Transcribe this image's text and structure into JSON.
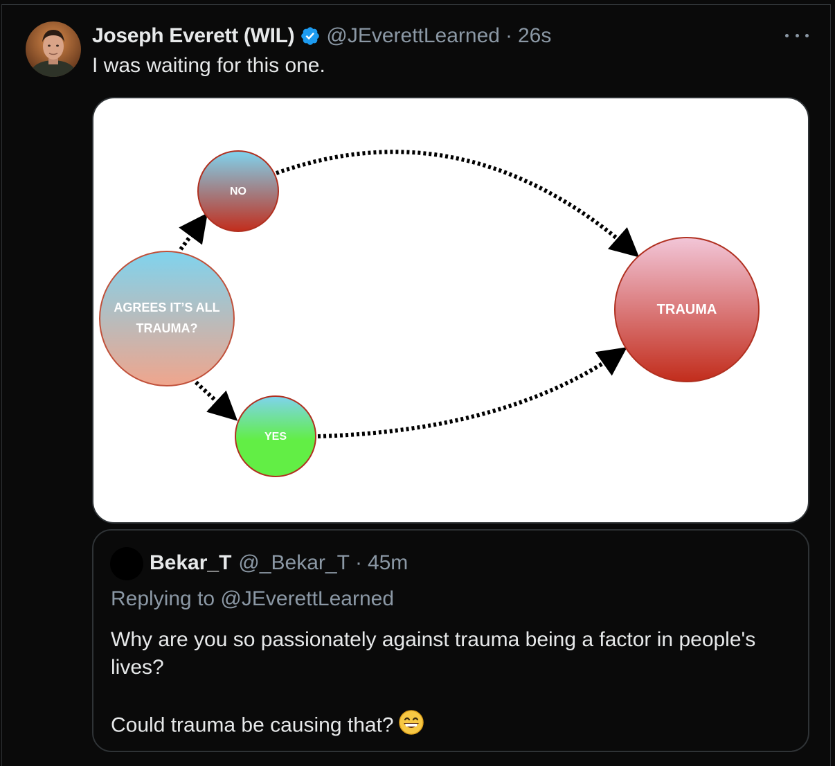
{
  "tweet": {
    "author_name": "Joseph Everett (WIL)",
    "handle": "@JEverettLearned",
    "separator": "·",
    "time": "26s",
    "text": "I was waiting for this one.",
    "verified_icon": "verified-badge-icon",
    "more_icon": "more-options-icon"
  },
  "diagram": {
    "nodes": {
      "agrees_line1": "AGREES IT’S ALL",
      "agrees_line2": "TRAUMA?",
      "no": "NO",
      "yes": "YES",
      "trauma": "TRAUMA"
    },
    "colors": {
      "blue": "#7fd3ee",
      "red": "#c22d1c",
      "salmon": "#f0a58c",
      "pink": "#f2c6d8",
      "green": "#62ee45"
    }
  },
  "quote": {
    "author_name": "Bekar_T",
    "handle": "@_Bekar_T",
    "separator": "·",
    "time": "45m",
    "replying_to": "Replying to @JEverettLearned",
    "text_line1": "Why are you so passionately against trauma being  a factor in people's lives?",
    "text_line2": "Could trauma be causing that?",
    "emoji": "grinning-face-icon"
  }
}
